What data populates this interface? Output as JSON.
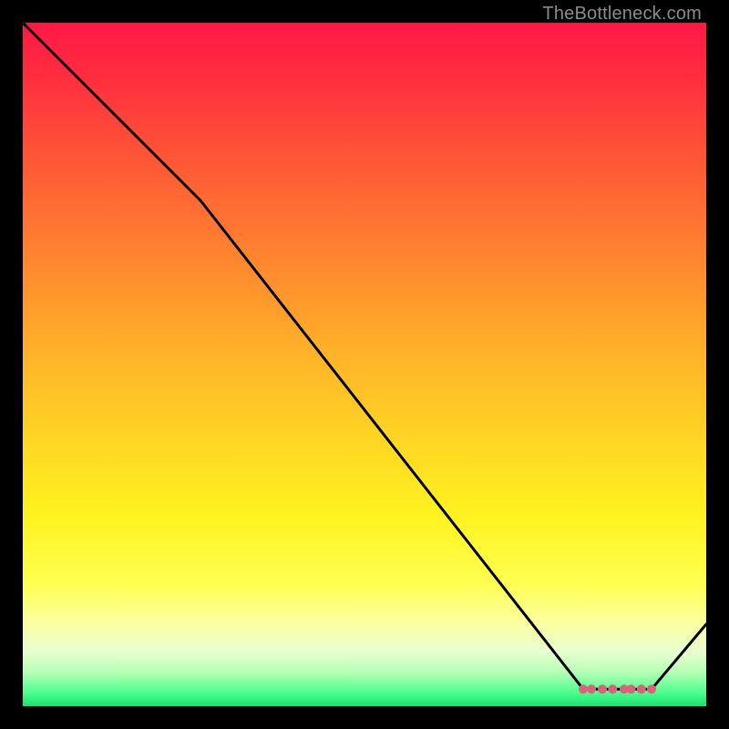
{
  "attribution": "TheBottleneck.com",
  "chart_data": {
    "type": "line",
    "title": "",
    "xlabel": "",
    "ylabel": "",
    "xlim": [
      0,
      100
    ],
    "ylim": [
      0,
      100
    ],
    "x": [
      0,
      26,
      82,
      86,
      92,
      100
    ],
    "values": [
      100,
      74,
      2.5,
      2.5,
      2.5,
      12
    ],
    "optimal_band": {
      "x_start": 82,
      "x_end": 92,
      "y": 2.5
    },
    "markers": [
      {
        "x": 82.0,
        "y": 2.5
      },
      {
        "x": 83.2,
        "y": 2.5
      },
      {
        "x": 84.8,
        "y": 2.5
      },
      {
        "x": 86.3,
        "y": 2.5
      },
      {
        "x": 88.0,
        "y": 2.5
      },
      {
        "x": 89.0,
        "y": 2.5
      },
      {
        "x": 90.5,
        "y": 2.5
      },
      {
        "x": 92.0,
        "y": 2.5
      }
    ],
    "marker_color": "#d9637a",
    "line_color": "#000000"
  }
}
